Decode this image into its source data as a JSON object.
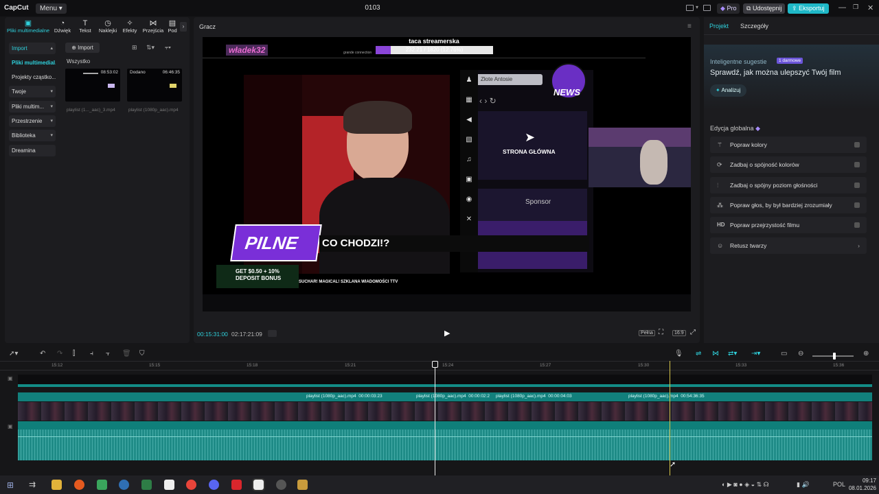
{
  "app": {
    "logo": "CapCut",
    "menu": "Menu",
    "project": "0103"
  },
  "titlebar": {
    "pro": "Pro",
    "share": "Udostępnij",
    "export": "Eksportuj"
  },
  "toolbar_tabs": [
    {
      "label": "Pliki multimedialne",
      "icon": "media-icon"
    },
    {
      "label": "Dźwięk",
      "icon": "audio-icon"
    },
    {
      "label": "Tekst",
      "icon": "text-icon"
    },
    {
      "label": "Naklejki",
      "icon": "sticker-icon"
    },
    {
      "label": "Efekty",
      "icon": "effects-icon"
    },
    {
      "label": "Przejścia",
      "icon": "transitions-icon"
    },
    {
      "label": "Pod",
      "icon": "captions-icon"
    }
  ],
  "sidebar": [
    {
      "label": "Import",
      "chevron": true
    },
    {
      "label": "Pliki multimedial...",
      "chevron": false
    },
    {
      "label": "Projekty cząstko...",
      "chevron": false
    },
    {
      "label": "Twoje",
      "chevron": true
    },
    {
      "label": "Pliki multim...",
      "chevron": true
    },
    {
      "label": "Przestrzenie",
      "chevron": true
    },
    {
      "label": "Biblioteka",
      "chevron": true
    },
    {
      "label": "Dreamina",
      "chevron": false
    }
  ],
  "media": {
    "import_label": "Import",
    "filter_label": "Wszystko",
    "clips": [
      {
        "duration": "08:53:02",
        "badge": "",
        "name": "playlist (1..._aac)_3.mp4"
      },
      {
        "duration": "06:46:35",
        "badge": "Dodano",
        "name": "playlist (1080p_aac).mp4"
      }
    ]
  },
  "player": {
    "title": "Gracz",
    "current_time": "00:15:31:00",
    "total_time": "02:17:21:09",
    "quality": "Pełna",
    "ratio": "16:9",
    "overlay": {
      "channel": "władek32",
      "goal_title": "taca streamerska",
      "goal_progress": "232.21 / 1820 (12.76%)",
      "goal_fraction": 0.1276,
      "connection": "grande connection",
      "news": "NEWS",
      "banner_tag": "PILNE",
      "banner_text": "CO CHODZI!?",
      "ad_text": "GET $0.50 + 10% DEPOSIT BONUS",
      "ticker": "SUCHAR! MAGICAL! SZKLANA WIADOMOŚCI TTV",
      "home": "STRONA GŁÓWNA",
      "sponsor": "Sponsor",
      "browser_tab": "Złote Antosie"
    }
  },
  "right": {
    "tab_project": "Projekt",
    "tab_details": "Szczegóły",
    "smart_title": "Inteligentne sugestie",
    "smart_badge": "1 darmowe",
    "smart_heading": "Sprawdź, jak można ulepszyć Twój film",
    "analyze": "Analizuj",
    "global_title": "Edycja globalna",
    "items": [
      {
        "label": "Popraw kolory",
        "icon": "magic-wand-icon"
      },
      {
        "label": "Zadbaj o spójność kolorów",
        "icon": "palette-icon"
      },
      {
        "label": "Zadbaj o spójny poziom głośności",
        "icon": "sliders-icon"
      },
      {
        "label": "Popraw głos, by był bardziej zrozumiały",
        "icon": "voice-icon"
      },
      {
        "label": "Popraw przejrzystość filmu",
        "icon": "hd-icon"
      },
      {
        "label": "Retusz twarzy",
        "icon": "face-icon"
      }
    ]
  },
  "timeline": {
    "ruler": [
      "15:12",
      "15:15",
      "15:18",
      "15:21",
      "15:24",
      "15:27",
      "15:30",
      "15:33",
      "15:36"
    ],
    "clips": [
      {
        "name": "playlist (1080p_aac).mp4",
        "time": "00:00:03:23"
      },
      {
        "name": "playlist (1080p_aac).mp4",
        "time": "00:00:02:2"
      },
      {
        "name": "playlist (1080p_aac).mp4",
        "time": "00:00:04:03"
      },
      {
        "name": "playlist (1080p_aac).mp4",
        "time": "00:54:36:35"
      }
    ]
  },
  "taskbar": {
    "lang": "POL",
    "time": "09:17",
    "date": "08.01.2026"
  }
}
